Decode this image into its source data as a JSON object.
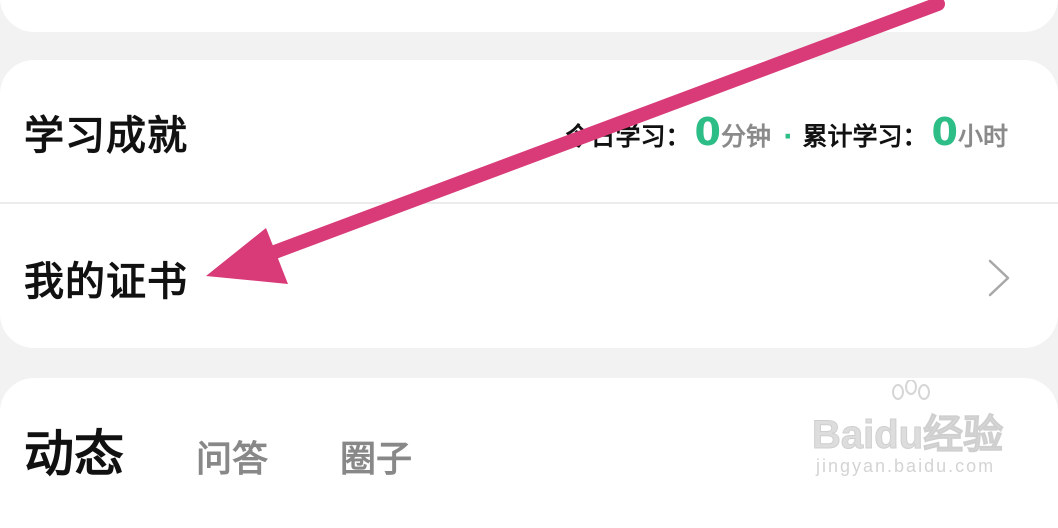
{
  "achievement": {
    "title": "学习成就",
    "today_label": "今日学习：",
    "today_value": "0",
    "today_unit": "分钟",
    "separator": "·",
    "total_label": "累计学习：",
    "total_value": "0",
    "total_unit": "小时"
  },
  "certificate": {
    "title": "我的证书",
    "chevron_icon": "chevron-right-icon"
  },
  "tabs": [
    {
      "label": "动态",
      "active": true
    },
    {
      "label": "问答",
      "active": false
    },
    {
      "label": "圈子",
      "active": false
    }
  ],
  "watermark": {
    "logo": "Baidu经验",
    "url": "jingyan.baidu.com"
  },
  "colors": {
    "accent_green": "#2dbd86",
    "arrow_pink": "#d93a78",
    "background": "#f2f2f2"
  }
}
